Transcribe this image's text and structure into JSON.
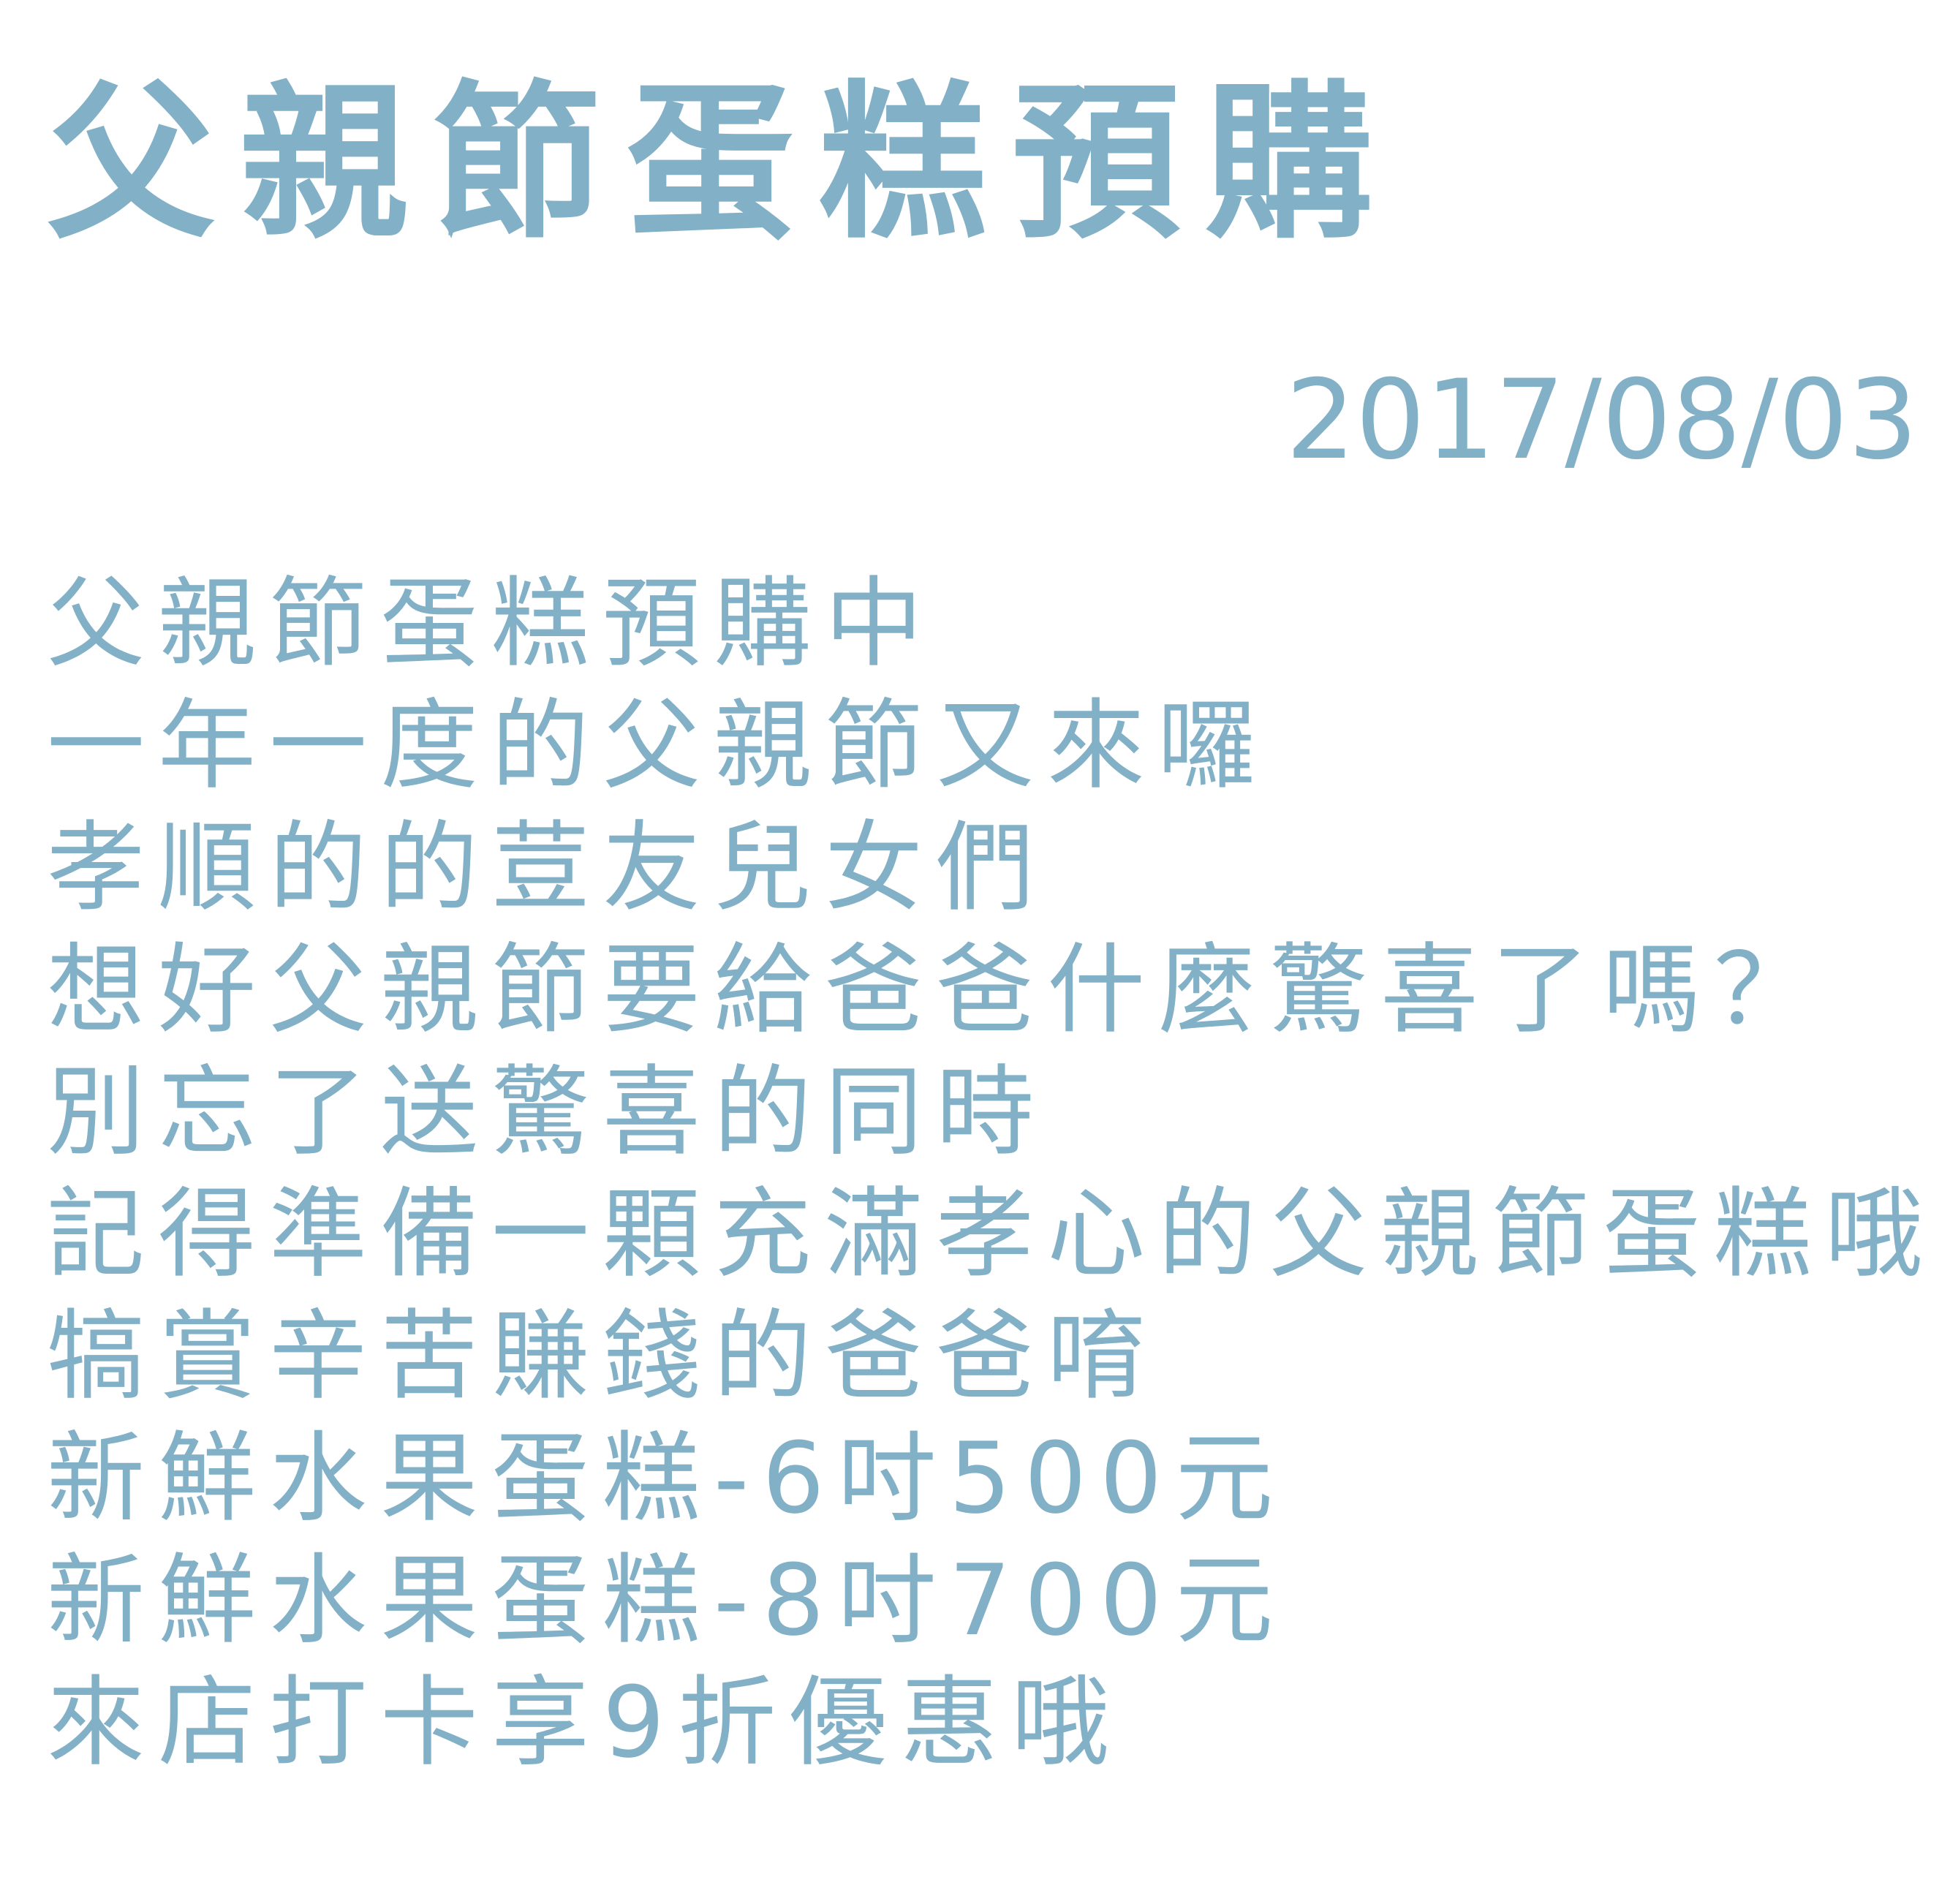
{
  "title": "父親節蛋糕預購",
  "date": "2017/08/03",
  "lines": [
    "父親節蛋糕預購中",
    "一年一度的父親節又來囉",
    "孝順的的荳友兒女們",
    "想好父親節要給爸爸什麼驚喜了嗎？",
    "別忘了送驚喜的同時",
    "記得準備一顆充滿孝心的父親節蛋糕哦",
    "犒賞辛苦賺錢的爸爸唷",
    "新鮮水果蛋糕-6吋500元",
    "新鮮水果蛋糕-8吋700元",
    "來店打卡享9折優惠哦"
  ]
}
